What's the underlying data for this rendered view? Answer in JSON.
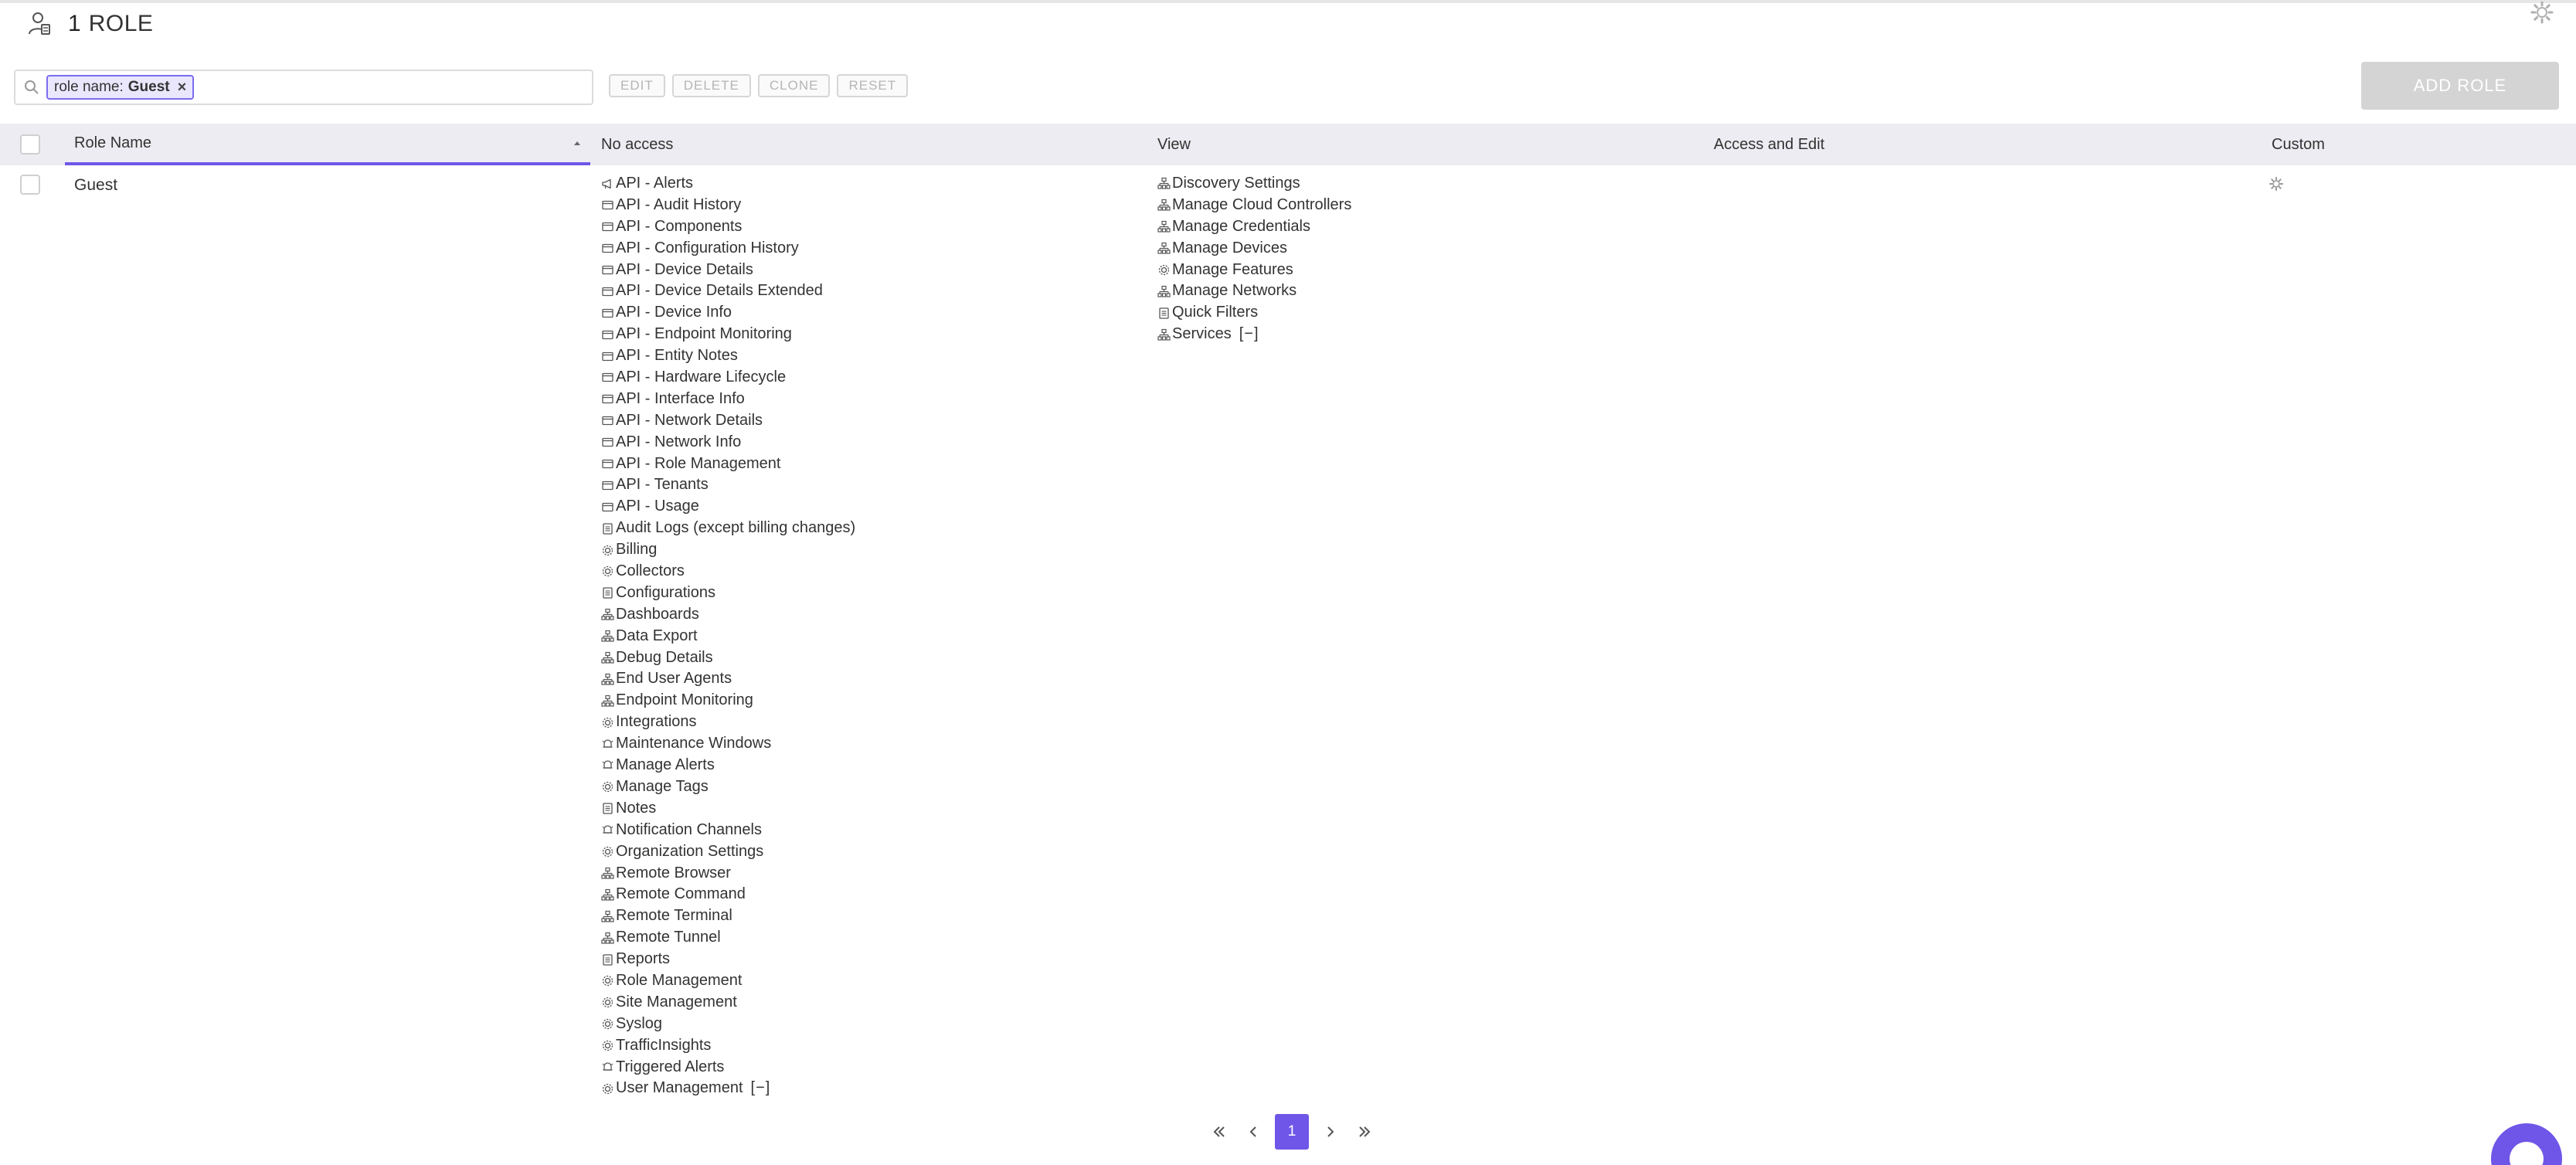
{
  "header": {
    "count": "1",
    "title": "ROLE"
  },
  "search": {
    "chip_key": "role name:",
    "chip_value": "Guest",
    "chip_close": "×",
    "placeholder": ""
  },
  "toolbar": {
    "edit_label": "EDIT",
    "delete_label": "DELETE",
    "clone_label": "CLONE",
    "reset_label": "RESET",
    "add_role_label": "ADD ROLE"
  },
  "table": {
    "columns": {
      "role_name": "Role Name",
      "no_access": "No access",
      "view": "View",
      "access_edit": "Access and Edit",
      "custom": "Custom"
    },
    "rows": [
      {
        "name": "Guest",
        "no_access": [
          {
            "label": "API - Alerts",
            "icon": "megaphone-icon"
          },
          {
            "label": "API - Audit History",
            "icon": "window-icon"
          },
          {
            "label": "API - Components",
            "icon": "window-icon"
          },
          {
            "label": "API - Configuration History",
            "icon": "window-icon"
          },
          {
            "label": "API - Device Details",
            "icon": "window-icon"
          },
          {
            "label": "API - Device Details Extended",
            "icon": "window-icon"
          },
          {
            "label": "API - Device Info",
            "icon": "window-icon"
          },
          {
            "label": "API - Endpoint Monitoring",
            "icon": "window-icon"
          },
          {
            "label": "API - Entity Notes",
            "icon": "window-icon"
          },
          {
            "label": "API - Hardware Lifecycle",
            "icon": "window-icon"
          },
          {
            "label": "API - Interface Info",
            "icon": "window-icon"
          },
          {
            "label": "API - Network Details",
            "icon": "window-icon"
          },
          {
            "label": "API - Network Info",
            "icon": "window-icon"
          },
          {
            "label": "API - Role Management",
            "icon": "window-icon"
          },
          {
            "label": "API - Tenants",
            "icon": "window-icon"
          },
          {
            "label": "API - Usage",
            "icon": "window-icon"
          },
          {
            "label": "Audit Logs (except billing changes)",
            "icon": "document-icon"
          },
          {
            "label": "Billing",
            "icon": "gear-icon"
          },
          {
            "label": "Collectors",
            "icon": "gear-icon"
          },
          {
            "label": "Configurations",
            "icon": "document-icon"
          },
          {
            "label": "Dashboards",
            "icon": "network-icon"
          },
          {
            "label": "Data Export",
            "icon": "network-icon"
          },
          {
            "label": "Debug Details",
            "icon": "network-icon"
          },
          {
            "label": "End User Agents",
            "icon": "network-icon"
          },
          {
            "label": "Endpoint Monitoring",
            "icon": "network-icon"
          },
          {
            "label": "Integrations",
            "icon": "gear-icon"
          },
          {
            "label": "Maintenance Windows",
            "icon": "bell-icon"
          },
          {
            "label": "Manage Alerts",
            "icon": "bell-icon"
          },
          {
            "label": "Manage Tags",
            "icon": "gear-icon"
          },
          {
            "label": "Notes",
            "icon": "document-icon"
          },
          {
            "label": "Notification Channels",
            "icon": "bell-icon"
          },
          {
            "label": "Organization Settings",
            "icon": "gear-icon"
          },
          {
            "label": "Remote Browser",
            "icon": "network-icon"
          },
          {
            "label": "Remote Command",
            "icon": "network-icon"
          },
          {
            "label": "Remote Terminal",
            "icon": "network-icon"
          },
          {
            "label": "Remote Tunnel",
            "icon": "network-icon"
          },
          {
            "label": "Reports",
            "icon": "document-icon"
          },
          {
            "label": "Role Management",
            "icon": "gear-icon"
          },
          {
            "label": "Site Management",
            "icon": "gear-icon"
          },
          {
            "label": "Syslog",
            "icon": "gear-icon"
          },
          {
            "label": "TrafficInsights",
            "icon": "gear-icon"
          },
          {
            "label": "Triggered Alerts",
            "icon": "bell-icon"
          },
          {
            "label": "User Management",
            "icon": "gear-icon",
            "toggle": "[−]"
          }
        ],
        "view": [
          {
            "label": "Discovery Settings",
            "icon": "network-icon"
          },
          {
            "label": "Manage Cloud Controllers",
            "icon": "network-icon"
          },
          {
            "label": "Manage Credentials",
            "icon": "network-icon"
          },
          {
            "label": "Manage Devices",
            "icon": "network-icon"
          },
          {
            "label": "Manage Features",
            "icon": "gear-icon"
          },
          {
            "label": "Manage Networks",
            "icon": "network-icon"
          },
          {
            "label": "Quick Filters",
            "icon": "document-icon"
          },
          {
            "label": "Services",
            "icon": "network-icon",
            "toggle": "[−]"
          }
        ],
        "access_edit": []
      }
    ]
  },
  "pagination": {
    "current_page": "1"
  },
  "colors": {
    "accent": "#6f56e8",
    "header_bg": "#ececf2",
    "chip_bg": "#eae7fd"
  }
}
